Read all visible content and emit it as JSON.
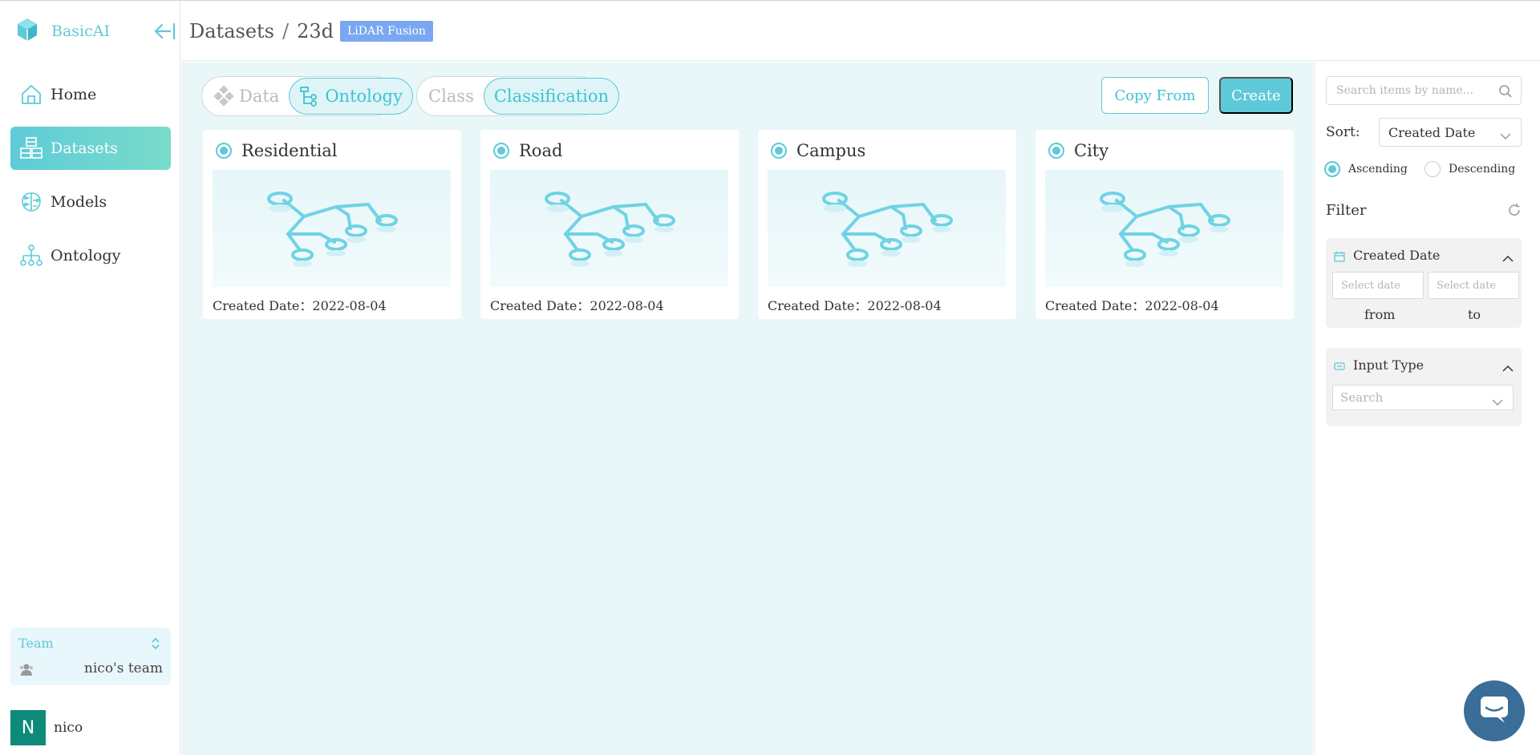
{
  "brand": {
    "name": "BasicAI"
  },
  "nav": {
    "items": [
      {
        "label": "Home",
        "icon": "home-icon"
      },
      {
        "label": "Datasets",
        "icon": "datasets-icon",
        "active": true
      },
      {
        "label": "Models",
        "icon": "models-icon"
      },
      {
        "label": "Ontology",
        "icon": "ontology-icon"
      }
    ]
  },
  "team": {
    "label": "Team",
    "name": "nico's team"
  },
  "user": {
    "initial": "N",
    "name": "nico"
  },
  "header": {
    "crumb_root": "Datasets",
    "separator": "/",
    "dataset": "23d",
    "badge": "LiDAR Fusion"
  },
  "tabs": {
    "view": [
      {
        "label": "Data"
      },
      {
        "label": "Ontology",
        "active": true
      }
    ],
    "kind": [
      {
        "label": "Class"
      },
      {
        "label": "Classification",
        "active": true
      }
    ]
  },
  "actions": {
    "copy_from": "Copy From",
    "create": "Create"
  },
  "cards": [
    {
      "title": "Residential",
      "date": "Created Date：2022-08-04"
    },
    {
      "title": "Road",
      "date": "Created Date：2022-08-04"
    },
    {
      "title": "Campus",
      "date": "Created Date：2022-08-04"
    },
    {
      "title": "City",
      "date": "Created Date：2022-08-04"
    }
  ],
  "panel": {
    "search_placeholder": "Search items by name...",
    "sort_label": "Sort:",
    "sort_value": "Created Date",
    "ascending": "Ascending",
    "descending": "Descending",
    "order": "ascending",
    "filter_label": "Filter",
    "created_date": {
      "title": "Created Date",
      "from_placeholder": "Select date",
      "to_placeholder": "Select date",
      "from_label": "from",
      "to_label": "to"
    },
    "input_type": {
      "title": "Input Type",
      "placeholder": "Search"
    }
  },
  "colors": {
    "accent": "#5ec9d8",
    "main_bg": "#eaf7f8",
    "badge": "#7aa7f0",
    "avatar": "#0d8a7a"
  }
}
